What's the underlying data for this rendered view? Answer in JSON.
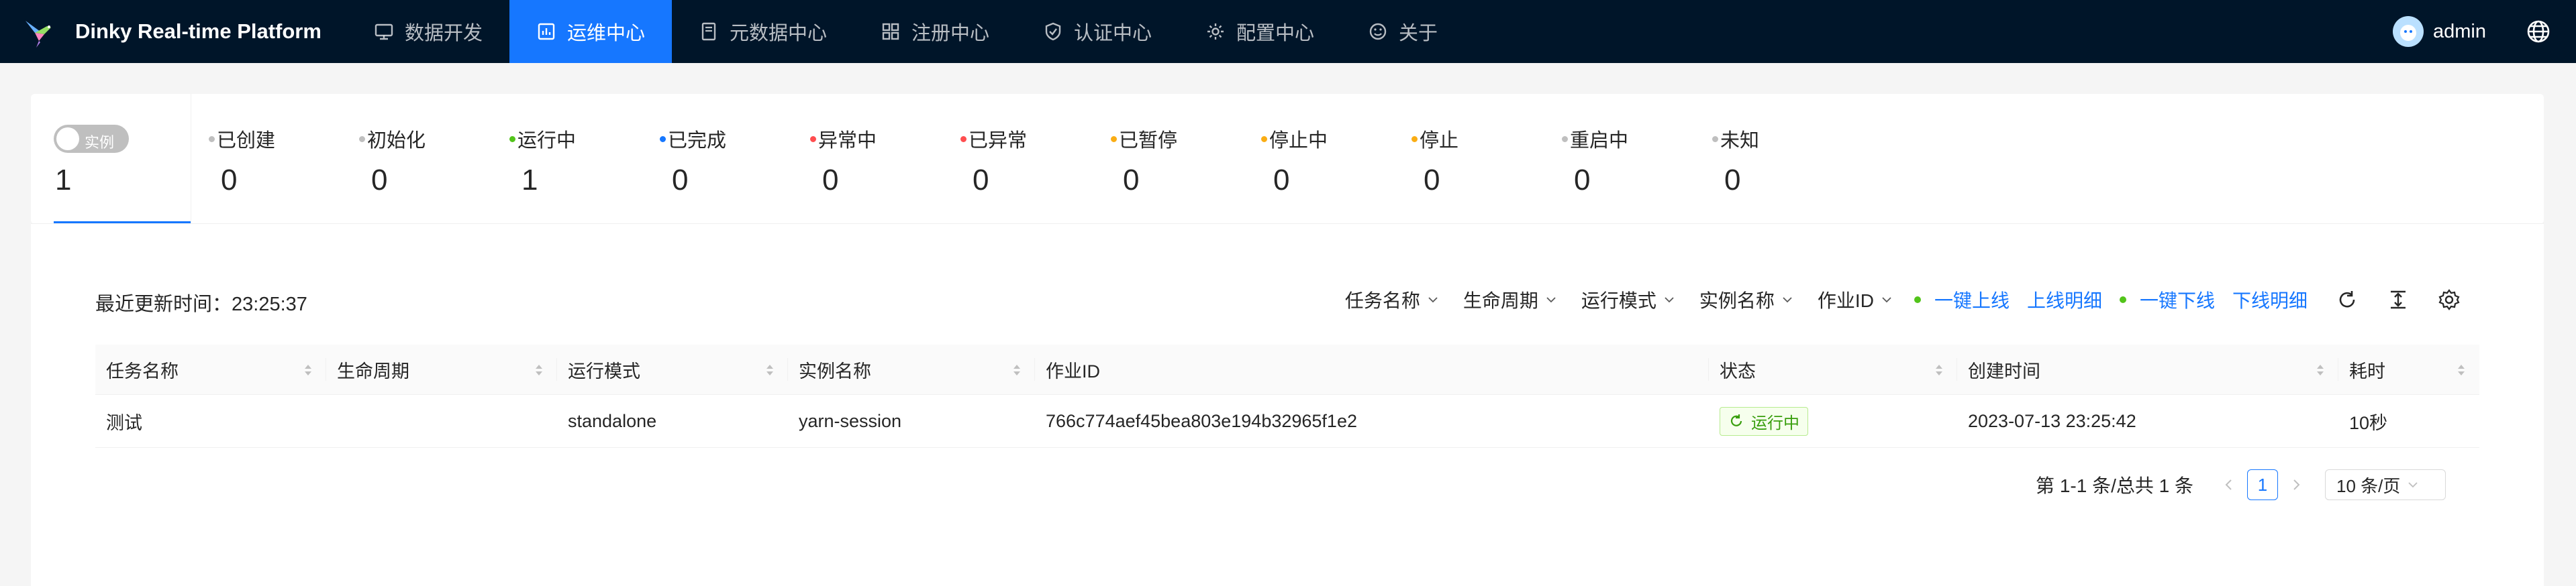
{
  "header": {
    "brand": "Dinky Real-time Platform",
    "nav": [
      {
        "label": "数据开发",
        "icon": "monitor-icon"
      },
      {
        "label": "运维中心",
        "icon": "dashboard-icon",
        "active": true
      },
      {
        "label": "元数据中心",
        "icon": "book-icon"
      },
      {
        "label": "注册中心",
        "icon": "appstore-icon"
      },
      {
        "label": "认证中心",
        "icon": "shield-icon"
      },
      {
        "label": "配置中心",
        "icon": "gear-icon"
      },
      {
        "label": "关于",
        "icon": "smile-icon"
      }
    ],
    "user": "admin",
    "accent": "#1677ff",
    "bg": "#001529"
  },
  "status": {
    "toggle_label": "实例",
    "toggle_count": "1",
    "items": [
      {
        "label": "已创建",
        "count": "0",
        "color": "#bfbfbf"
      },
      {
        "label": "初始化",
        "count": "0",
        "color": "#bfbfbf"
      },
      {
        "label": "运行中",
        "count": "1",
        "color": "#52c41a"
      },
      {
        "label": "已完成",
        "count": "0",
        "color": "#1677ff"
      },
      {
        "label": "异常中",
        "count": "0",
        "color": "#ff4d4f"
      },
      {
        "label": "已异常",
        "count": "0",
        "color": "#ff4d4f"
      },
      {
        "label": "已暂停",
        "count": "0",
        "color": "#faad14"
      },
      {
        "label": "停止中",
        "count": "0",
        "color": "#faad14"
      },
      {
        "label": "停止",
        "count": "0",
        "color": "#faad14"
      },
      {
        "label": "重启中",
        "count": "0",
        "color": "#bfbfbf"
      },
      {
        "label": "未知",
        "count": "0",
        "color": "#bfbfbf"
      }
    ]
  },
  "toolbar": {
    "updated_label": "最近更新时间：",
    "updated_time": "23:25:37",
    "filters": [
      "任务名称",
      "生命周期",
      "运行模式",
      "实例名称",
      "作业ID"
    ],
    "one_click_online": "一键上线",
    "online_detail": "上线明细",
    "one_click_offline": "一键下线",
    "offline_detail": "下线明细"
  },
  "table": {
    "columns": [
      "任务名称",
      "生命周期",
      "运行模式",
      "实例名称",
      "作业ID",
      "状态",
      "创建时间",
      "耗时"
    ],
    "rows": [
      {
        "name": "测试",
        "lifecycle": "",
        "mode": "standalone",
        "instance": "yarn-session",
        "job_id": "766c774aef45bea803e194b32965f1e2",
        "status": "运行中",
        "created": "2023-07-13 23:25:42",
        "duration": "10秒"
      }
    ]
  },
  "pagination": {
    "total_text": "第 1-1 条/总共 1 条",
    "current_page": "1",
    "page_size": "10 条/页"
  }
}
